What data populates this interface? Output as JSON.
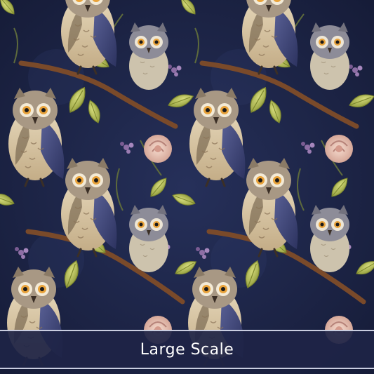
{
  "banner": {
    "label": "Large Scale"
  },
  "palette": {
    "background": "#1c2448",
    "owl_body": "#d9c7a6",
    "owl_wing": "#3e4574",
    "owl_grey": "#8d8c98",
    "eye": "#e8a23a",
    "leaf": "#b9c257",
    "branch": "#7a4a2a",
    "rose": "#e9c1b3",
    "flower": "#8e6ea5"
  },
  "motifs": [
    "owl",
    "leaf",
    "branch",
    "rose",
    "flower"
  ]
}
